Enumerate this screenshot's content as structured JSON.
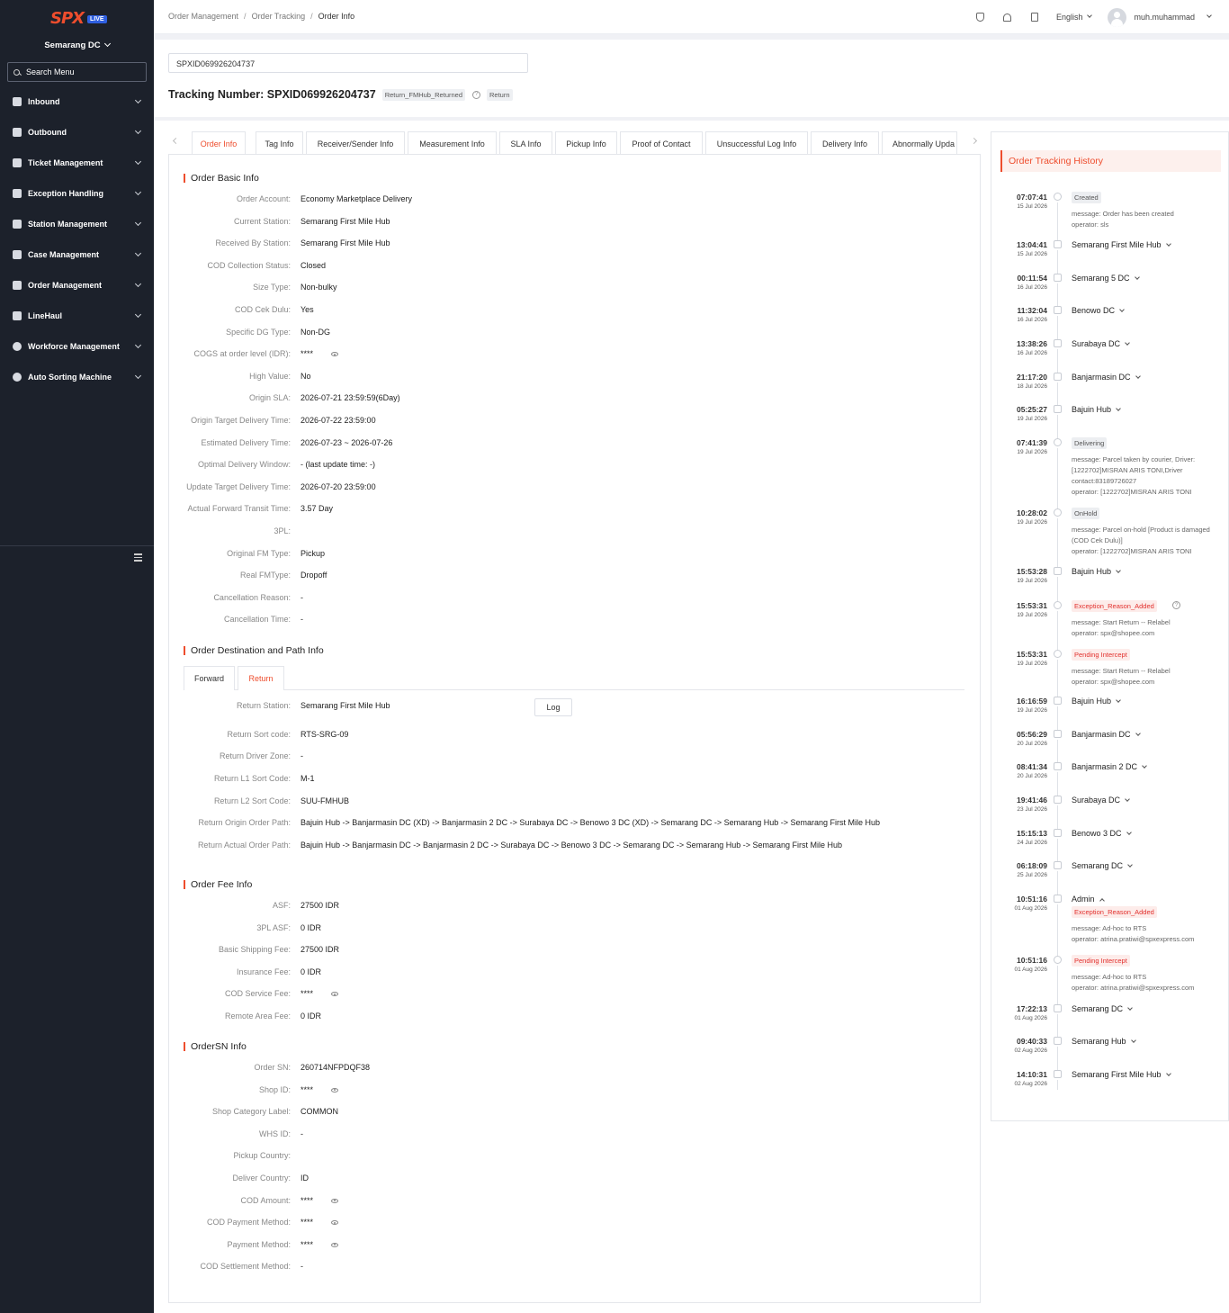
{
  "app": {
    "logo_text": "SPX",
    "logo_badge": "LIVE",
    "station": "Semarang DC",
    "search_placeholder": "Search Menu"
  },
  "menu": [
    {
      "label": "Inbound",
      "icon": "inbound-icon"
    },
    {
      "label": "Outbound",
      "icon": "outbound-icon"
    },
    {
      "label": "Ticket Management",
      "icon": "ticket-icon"
    },
    {
      "label": "Exception Handling",
      "icon": "exception-icon"
    },
    {
      "label": "Station Management",
      "icon": "home-icon"
    },
    {
      "label": "Case Management",
      "icon": "case-icon"
    },
    {
      "label": "Order Management",
      "icon": "order-icon"
    },
    {
      "label": "LineHaul",
      "icon": "truck-icon"
    },
    {
      "label": "Workforce Management",
      "icon": "user-icon"
    },
    {
      "label": "Auto Sorting Machine",
      "icon": "sorting-icon"
    }
  ],
  "header": {
    "breadcrumb": [
      "Order Management",
      "Order Tracking",
      "Order Info"
    ],
    "language": "English",
    "username": "muh.muhammad"
  },
  "tracking": {
    "input_value": "SPXID069926204737",
    "title_prefix": "Tracking Number:",
    "number": "SPXID069926204737",
    "status_badge": "Return_FMHub_Returned",
    "type_badge": "Return"
  },
  "tabs": [
    "Order Info",
    "Tag Info",
    "Receiver/Sender Info",
    "Measurement Info",
    "SLA Info",
    "Pickup Info",
    "Proof of Contact",
    "Unsuccessful Log Info",
    "Delivery Info",
    "Abnormally Upda"
  ],
  "basic_info": {
    "title": "Order Basic Info",
    "rows": [
      {
        "label": "Order Account:",
        "value": "Economy Marketplace Delivery"
      },
      {
        "label": "Current Station:",
        "value": "Semarang First Mile Hub"
      },
      {
        "label": "Received By Station:",
        "value": "Semarang First Mile Hub"
      },
      {
        "label": "COD Collection Status:",
        "value": "Closed"
      },
      {
        "label": "Size Type:",
        "value": "Non-bulky"
      },
      {
        "label": "COD Cek Dulu:",
        "value": "Yes"
      },
      {
        "label": "Specific DG Type:",
        "value": "Non-DG"
      },
      {
        "label": "COGS at order level (IDR):",
        "value": "****",
        "masked": true
      },
      {
        "label": "High Value:",
        "value": "No"
      },
      {
        "label": "Origin SLA:",
        "value": "2026-07-21 23:59:59(6Day)"
      },
      {
        "label": "Origin Target Delivery Time:",
        "value": "2026-07-22 23:59:00"
      },
      {
        "label": "Estimated Delivery Time:",
        "value": "2026-07-23 ~ 2026-07-26"
      },
      {
        "label": "Optimal Delivery Window:",
        "value": "- (last update time: -)"
      },
      {
        "label": "Update Target Delivery Time:",
        "value": "2026-07-20 23:59:00"
      },
      {
        "label": "Actual Forward Transit Time:",
        "value": "3.57 Day"
      },
      {
        "label": "3PL:",
        "value": ""
      },
      {
        "label": "Original FM Type:",
        "value": "Pickup"
      },
      {
        "label": "Real FMType:",
        "value": "Dropoff"
      },
      {
        "label": "Cancellation Reason:",
        "value": "-"
      },
      {
        "label": "Cancellation Time:",
        "value": "-"
      }
    ]
  },
  "path_info": {
    "title": "Order Destination and Path Info",
    "tabs": [
      "Forward",
      "Return"
    ],
    "log_label": "Log",
    "rows": [
      {
        "label": "Return Station:",
        "value": "Semarang First Mile Hub"
      },
      {
        "label": "Return Sort code:",
        "value": "RTS-SRG-09"
      },
      {
        "label": "Return Driver Zone:",
        "value": "-"
      },
      {
        "label": "Return L1 Sort Code:",
        "value": "M-1"
      },
      {
        "label": "Return L2 Sort Code:",
        "value": "SUU-FMHUB"
      },
      {
        "label": "Return Origin Order Path:",
        "value": "Bajuin Hub  -> Banjarmasin DC (XD)  -> Banjarmasin 2 DC  -> Surabaya DC  -> Benowo 3 DC (XD)  -> Semarang DC  -> Semarang Hub  -> Semarang First Mile Hub"
      },
      {
        "label": "Return Actual Order Path:",
        "value": "Bajuin Hub  -> Banjarmasin DC  -> Banjarmasin 2 DC  -> Surabaya DC  -> Benowo 3 DC  -> Semarang DC  -> Semarang Hub  -> Semarang First Mile Hub"
      }
    ]
  },
  "fee_info": {
    "title": "Order Fee Info",
    "rows": [
      {
        "label": "ASF:",
        "value": "27500 IDR"
      },
      {
        "label": "3PL ASF:",
        "value": "0 IDR"
      },
      {
        "label": "Basic Shipping Fee:",
        "value": "27500 IDR"
      },
      {
        "label": "Insurance Fee:",
        "value": "0 IDR"
      },
      {
        "label": "COD Service Fee:",
        "value": "****",
        "masked": true
      },
      {
        "label": "Remote Area Fee:",
        "value": "0 IDR"
      }
    ]
  },
  "sn_info": {
    "title": "OrderSN Info",
    "rows": [
      {
        "label": "Order SN:",
        "value": "260714NFPDQF38"
      },
      {
        "label": "Shop ID:",
        "value": "****",
        "masked": true
      },
      {
        "label": "Shop Category Label:",
        "value": "COMMON"
      },
      {
        "label": "WHS ID:",
        "value": "-"
      },
      {
        "label": "Pickup Country:",
        "value": ""
      },
      {
        "label": "Deliver Country:",
        "value": "ID"
      },
      {
        "label": "COD Amount:",
        "value": "****",
        "masked": true
      },
      {
        "label": "COD Payment Method:",
        "value": "****",
        "masked": true
      },
      {
        "label": "Payment Method:",
        "value": "****",
        "masked": true
      },
      {
        "label": "COD Settlement Method:",
        "value": "-"
      }
    ]
  },
  "history": {
    "title": "Order Tracking History",
    "events": [
      {
        "time": "07:07:41",
        "date": "15 Jul 2026",
        "tag": "Created",
        "tag_color": "grey",
        "messages": [
          "message: Order has been created",
          "operator: sls"
        ]
      },
      {
        "time": "13:04:41",
        "date": "15 Jul 2026",
        "station": "Semarang First Mile Hub",
        "chevron": "down"
      },
      {
        "time": "00:11:54",
        "date": "16 Jul 2026",
        "station": "Semarang 5 DC",
        "chevron": "down"
      },
      {
        "time": "11:32:04",
        "date": "16 Jul 2026",
        "station": "Benowo DC",
        "chevron": "down"
      },
      {
        "time": "13:38:26",
        "date": "16 Jul 2026",
        "station": "Surabaya DC",
        "chevron": "down"
      },
      {
        "time": "21:17:20",
        "date": "18 Jul 2026",
        "station": "Banjarmasin DC",
        "chevron": "down"
      },
      {
        "time": "05:25:27",
        "date": "19 Jul 2026",
        "station": "Bajuin Hub",
        "chevron": "down"
      },
      {
        "time": "07:41:39",
        "date": "19 Jul 2026",
        "tag": "Delivering",
        "tag_color": "grey",
        "messages": [
          "message: Parcel taken by courier, Driver: [1222702]MISRAN ARIS TONI,Driver contact:83189726027",
          "operator: [1222702]MISRAN ARIS TONI"
        ]
      },
      {
        "time": "10:28:02",
        "date": "19 Jul 2026",
        "tag": "OnHold",
        "tag_color": "grey",
        "messages": [
          "message: Parcel on-hold [Product is damaged (COD Cek Dulu)]",
          "operator: [1222702]MISRAN ARIS TONI"
        ]
      },
      {
        "time": "15:53:28",
        "date": "19 Jul 2026",
        "station": "Bajuin Hub",
        "chevron": "down"
      },
      {
        "time": "15:53:31",
        "date": "19 Jul 2026",
        "tag": "Exception_Reason_Added",
        "tag_color": "red",
        "help": true,
        "messages": [
          "message: Start Return -- Relabel",
          "operator: spx@shopee.com"
        ]
      },
      {
        "time": "15:53:31",
        "date": "19 Jul 2026",
        "tag": "Pending Intercept",
        "tag_color": "red",
        "messages": [
          "message: Start Return -- Relabel",
          "operator: spx@shopee.com"
        ]
      },
      {
        "time": "16:16:59",
        "date": "19 Jul 2026",
        "station": "Bajuin Hub",
        "chevron": "down"
      },
      {
        "time": "05:56:29",
        "date": "20 Jul 2026",
        "station": "Banjarmasin DC",
        "chevron": "down"
      },
      {
        "time": "08:41:34",
        "date": "20 Jul 2026",
        "station": "Banjarmasin 2 DC",
        "chevron": "down"
      },
      {
        "time": "19:41:46",
        "date": "23 Jul 2026",
        "station": "Surabaya DC",
        "chevron": "down"
      },
      {
        "time": "15:15:13",
        "date": "24 Jul 2026",
        "station": "Benowo 3 DC",
        "chevron": "down"
      },
      {
        "time": "06:18:09",
        "date": "25 Jul 2026",
        "station": "Semarang DC",
        "chevron": "down"
      },
      {
        "time": "10:51:16",
        "date": "01 Aug 2026",
        "station": "Admin",
        "chevron": "up",
        "tag": "Exception_Reason_Added",
        "tag_color": "red",
        "messages": [
          "message: Ad-hoc to RTS",
          "operator: atrina.pratiwi@spxexpress.com"
        ]
      },
      {
        "time": "10:51:16",
        "date": "01 Aug 2026",
        "tag": "Pending Intercept",
        "tag_color": "red",
        "messages": [
          "message: Ad-hoc to RTS",
          "operator: atrina.pratiwi@spxexpress.com"
        ]
      },
      {
        "time": "17:22:13",
        "date": "01 Aug 2026",
        "station": "Semarang DC",
        "chevron": "down"
      },
      {
        "time": "09:40:33",
        "date": "02 Aug 2026",
        "station": "Semarang Hub",
        "chevron": "down"
      },
      {
        "time": "14:10:31",
        "date": "02 Aug 2026",
        "station": "Semarang First Mile Hub",
        "chevron": "down"
      }
    ]
  }
}
